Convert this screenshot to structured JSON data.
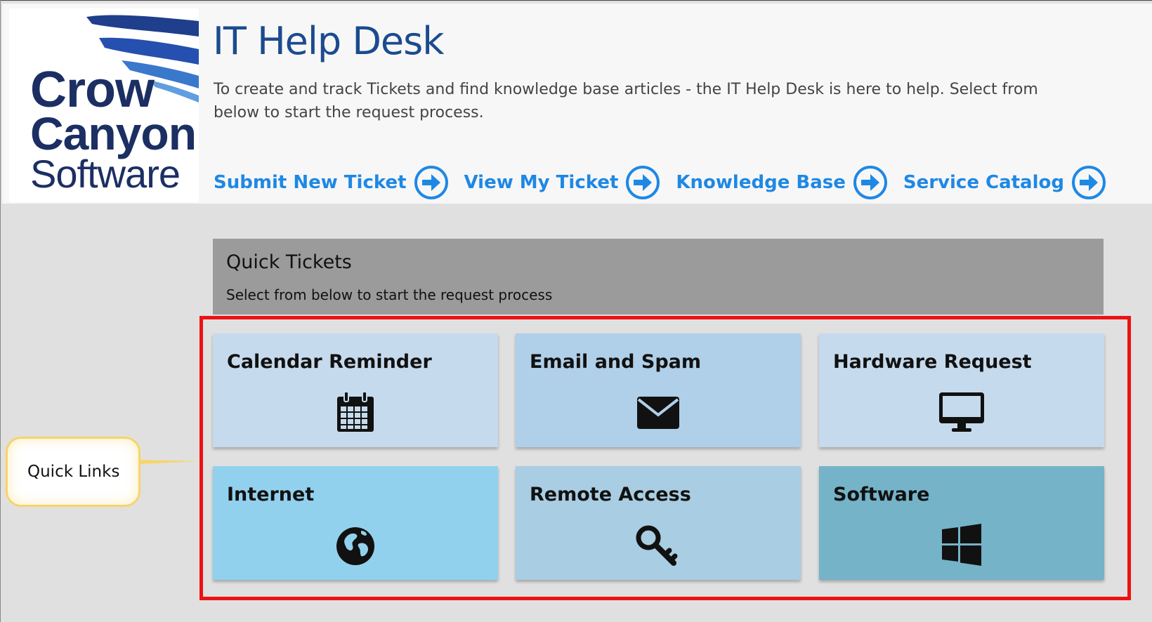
{
  "header": {
    "logo": {
      "line1": "Crow",
      "line2": "Canyon",
      "line3": "Software"
    },
    "title": "IT Help Desk",
    "description": "To create and track Tickets and find knowledge base articles - the IT Help Desk is here to help. Select from below to start the request process.",
    "nav": [
      {
        "label": "Submit New Ticket"
      },
      {
        "label": "View My Ticket"
      },
      {
        "label": "Knowledge Base"
      },
      {
        "label": "Service Catalog"
      }
    ]
  },
  "quick_tickets": {
    "title": "Quick Tickets",
    "subtitle": "Select from below to start the request process",
    "tiles": [
      {
        "label": "Calendar Reminder",
        "icon": "calendar-icon",
        "color": "#c6daed"
      },
      {
        "label": "Email and Spam",
        "icon": "envelope-icon",
        "color": "#b0cfe8"
      },
      {
        "label": "Hardware Request",
        "icon": "monitor-icon",
        "color": "#c6daed"
      },
      {
        "label": "Internet",
        "icon": "globe-icon",
        "color": "#92d1ee"
      },
      {
        "label": "Remote Access",
        "icon": "key-icon",
        "color": "#a9cde2"
      },
      {
        "label": "Software",
        "icon": "windows-icon",
        "color": "#75b3c9"
      }
    ]
  },
  "annotation": {
    "callout_label": "Quick Links",
    "highlight_color": "#ee1111",
    "callout_border_color": "#f7d46a"
  },
  "colors": {
    "accent": "#1e88e5",
    "title": "#1b4b8f",
    "header_bg": "#f7f7f7",
    "page_bg": "#e0e0e0",
    "quick_header_bg": "#9b9b9b"
  }
}
